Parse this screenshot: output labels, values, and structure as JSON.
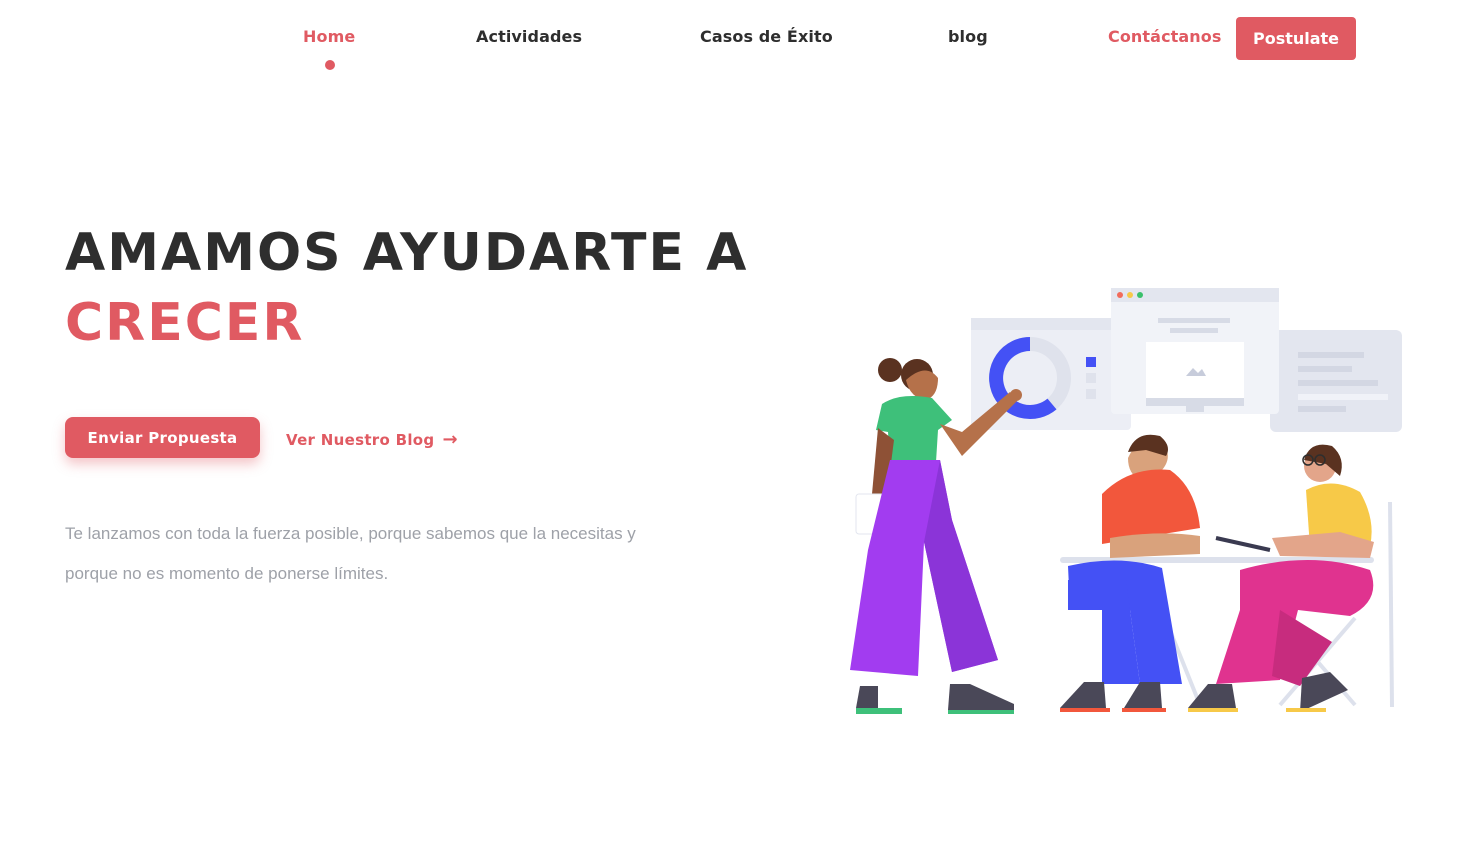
{
  "nav": {
    "items": [
      {
        "label": "Home",
        "active": true
      },
      {
        "label": "Actividades"
      },
      {
        "label": "Casos de Éxito"
      },
      {
        "label": "blog"
      },
      {
        "label": "Contáctanos",
        "accent": true
      }
    ],
    "cta_label": "Postulate"
  },
  "hero": {
    "title_line1": "AMAMOS AYUDARTE A",
    "title_line2": "CRECER",
    "primary_button": "Enviar Propuesta",
    "secondary_link": "Ver Nuestro Blog",
    "description": "Te lanzamos con toda la fuerza posible, porque sabemos que la necesitas y porque no es momento de ponerse límites."
  },
  "colors": {
    "accent": "#e05a62",
    "text_dark": "#2e2e2e",
    "text_muted": "#9ea1a8"
  },
  "icons": {
    "arrow": "arrow-right-icon"
  }
}
